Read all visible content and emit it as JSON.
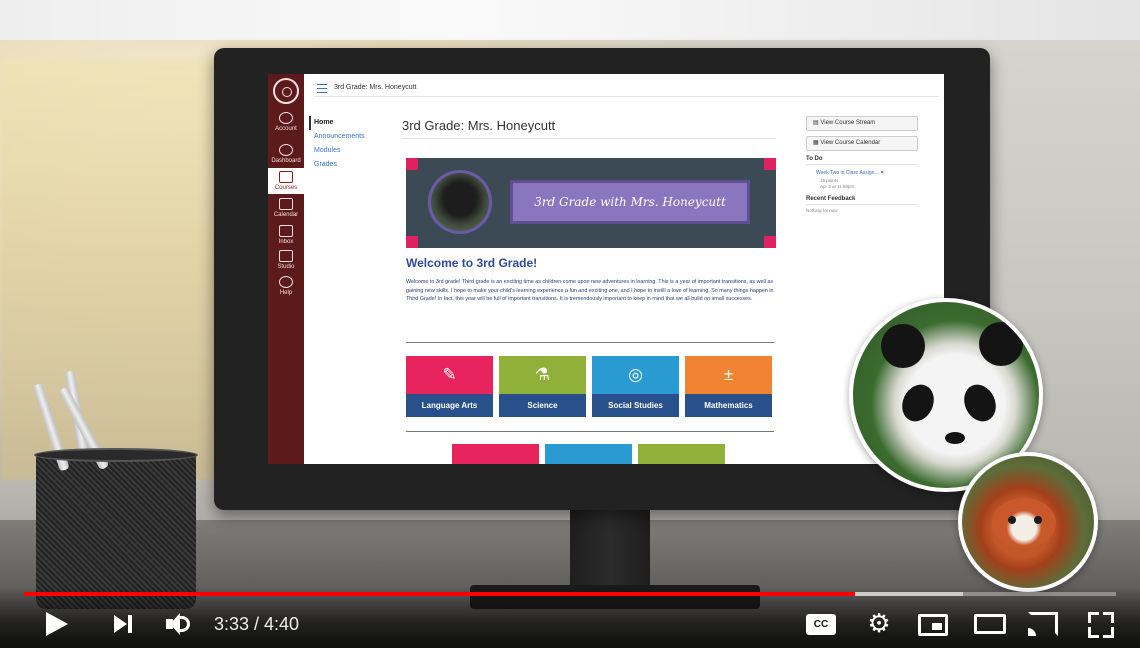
{
  "course": {
    "breadcrumb": "3rd Grade: Mrs. Honeycutt",
    "title": "3rd Grade: Mrs. Honeycutt",
    "banner_text": "3rd Grade with Mrs. Honeycutt",
    "welcome_heading": "Welcome to 3rd Grade!",
    "welcome_text": "Welcome to 3rd grade! Third grade is an exciting time as children come upon new adventures in learning. This is a year of important transitions, as well as gaining new skills. I hope to make your child's learning experience a fun and exciting one, and I hope to instill a love of learning. So many things happen in Third Grade! In fact, this year will be full of important transitions. It is tremendously important to keep in mind that we all build on small successes."
  },
  "global_nav": [
    {
      "label": "Account",
      "icon": "account-icon"
    },
    {
      "label": "Dashboard",
      "icon": "dashboard-icon"
    },
    {
      "label": "Courses",
      "icon": "courses-icon",
      "active": true
    },
    {
      "label": "Calendar",
      "icon": "calendar-icon"
    },
    {
      "label": "Inbox",
      "icon": "inbox-icon"
    },
    {
      "label": "Studio",
      "icon": "studio-icon"
    },
    {
      "label": "Help",
      "icon": "help-icon"
    }
  ],
  "course_nav": [
    "Home",
    "Announcements",
    "Modules",
    "Grades"
  ],
  "subjects": [
    {
      "label": "Language Arts",
      "color": "#e8245f",
      "icon": "pencil-icon"
    },
    {
      "label": "Science",
      "color": "#8fb13a",
      "icon": "flask-icon"
    },
    {
      "label": "Social Studies",
      "color": "#2a9ad3",
      "icon": "globe-icon"
    },
    {
      "label": "Mathematics",
      "color": "#f08432",
      "icon": "calculator-icon"
    }
  ],
  "sidebar": {
    "view_stream": "View Course Stream",
    "view_calendar": "View Course Calendar",
    "todo_heading": "To Do",
    "todo_item": "Week Two in Class Assign...",
    "todo_points": "15 points",
    "todo_due": "Apr 3 at 11:59pm",
    "feedback_heading": "Recent Feedback",
    "feedback_note": "Nothing for now"
  },
  "player": {
    "current_time": "3:33",
    "duration": "4:40",
    "time_display": "3:33 / 4:40",
    "played_fraction": 0.7607,
    "buffered_fraction": 0.86,
    "accent": "#ff0000",
    "cc_label": "CC"
  }
}
